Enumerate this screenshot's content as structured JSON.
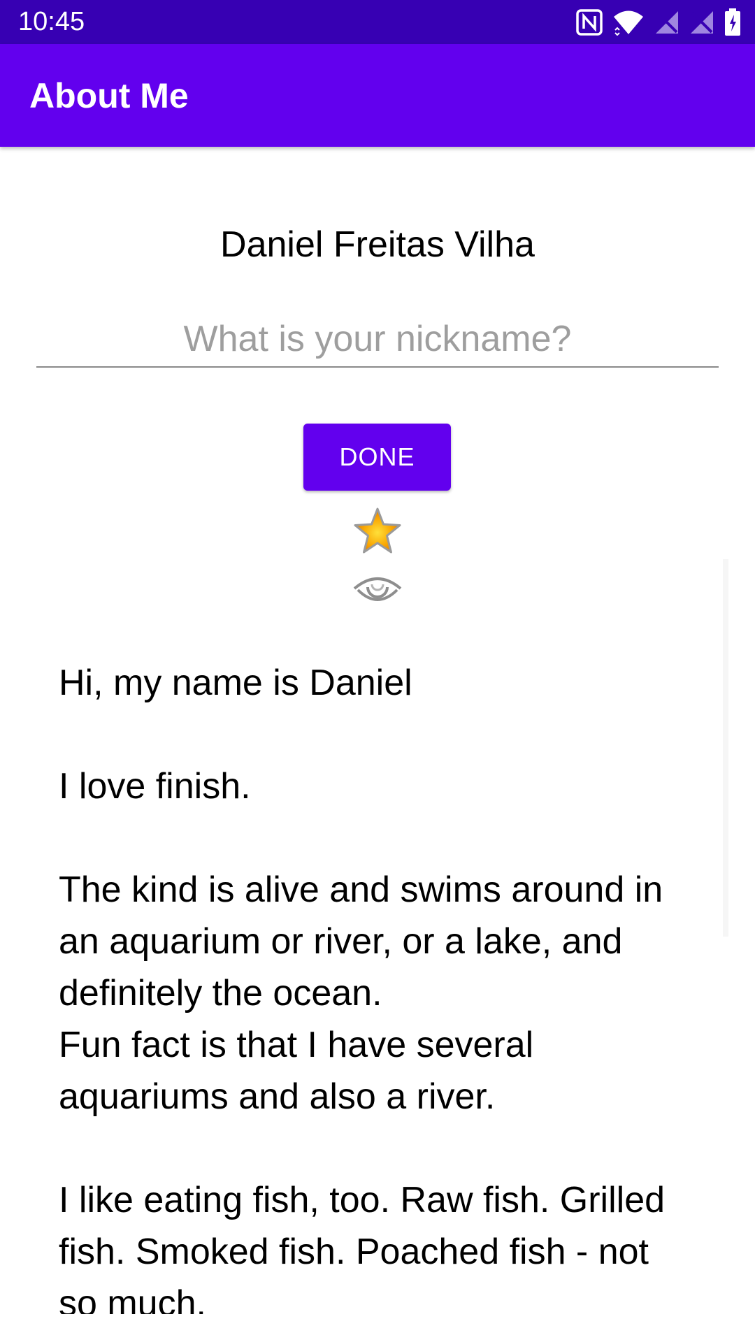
{
  "status_bar": {
    "time": "10:45",
    "icons": [
      "nfc-icon",
      "wifi-icon",
      "signal-off-icon",
      "signal-off-icon",
      "battery-icon"
    ]
  },
  "app_bar": {
    "title": "About Me"
  },
  "profile": {
    "name": "Daniel Freitas Vilha",
    "nickname_placeholder": "What is your nickname?",
    "nickname_value": "",
    "done_label": "DONE"
  },
  "icons": {
    "star": "star-icon",
    "eye": "eye-icon"
  },
  "bio": {
    "text": "Hi, my name is Daniel\n\nI love finish.\n\nThe kind is alive and swims around in an aquarium or river, or a lake, and definitely the ocean.\nFun fact is that I have several aquariums and also a river.\n\nI like eating fish, too. Raw fish. Grilled fish. Smoked fish. Poached fish - not so much."
  },
  "colors": {
    "status_bar": "#3700B3",
    "primary": "#6200EE",
    "on_primary": "#FFFFFF",
    "hint": "#9E9E9E",
    "star_fill": "#F5A300"
  }
}
